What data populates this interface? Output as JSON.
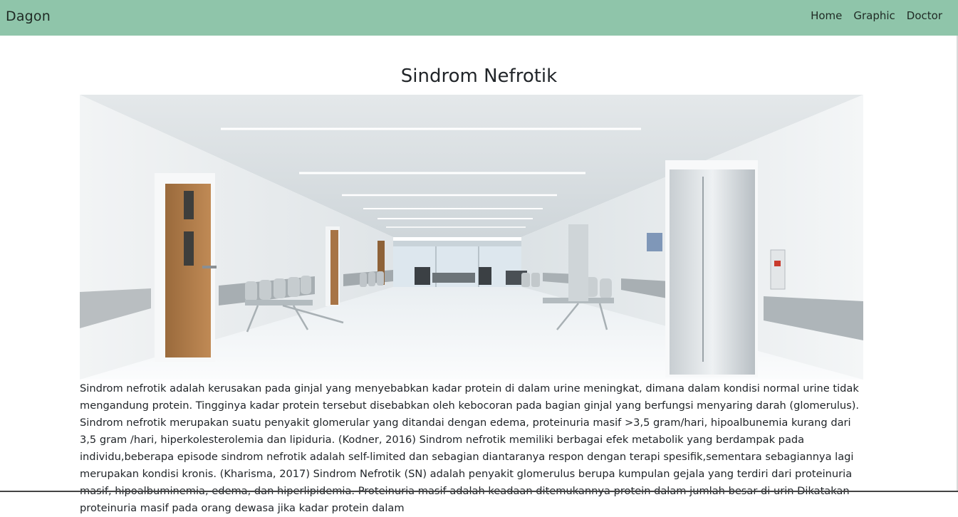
{
  "navbar": {
    "brand": "Dagon",
    "links": [
      "Home",
      "Graphic",
      "Doctor"
    ]
  },
  "main": {
    "title": "Sindrom Nefrotik",
    "image": "hospital-corridor-photo",
    "paragraph": "Sindrom nefrotik adalah kerusakan pada ginjal yang menyebabkan kadar protein di dalam urine meningkat, dimana dalam kondisi normal urine tidak mengandung protein. Tingginya kadar protein tersebut disebabkan oleh kebocoran pada bagian ginjal yang berfungsi menyaring darah (glomerulus). Sindrom nefrotik merupakan suatu penyakit glomerular yang ditandai dengan edema, proteinuria masif >3,5 gram/hari, hipoalbunemia kurang dari 3,5 gram /hari, hiperkolesterolemia dan lipiduria. (Kodner, 2016) Sindrom nefrotik memiliki berbagai efek metabolik yang berdampak pada individu,beberapa episode sindrom nefrotik adalah self-limited dan sebagian diantaranya respon dengan terapi spesifik,sementara sebagiannya lagi merupakan kondisi kronis. (Kharisma, 2017) Sindrom Nefrotik (SN) adalah penyakit glomerulus berupa kumpulan gejala yang terdiri dari proteinuria masif, hipoalbuminemia, edema, dan hiperlipidemia. Proteinuria masif adalah keadaan ditemukannya protein dalam jumlah besar di urin Dikatakan proteinuria masif pada orang dewasa jika kadar protein dalam"
  }
}
